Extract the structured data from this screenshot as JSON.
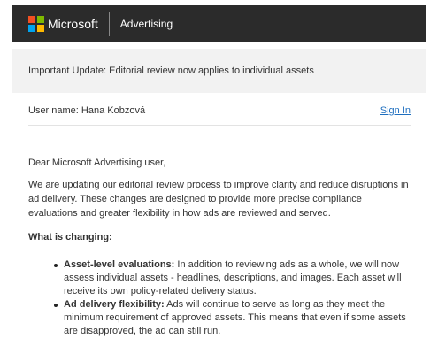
{
  "header": {
    "brand": "Microsoft",
    "product": "Advertising",
    "logo_colors": [
      "#f25022",
      "#7fba00",
      "#00a4ef",
      "#ffb900"
    ],
    "background": "#2b2b2b"
  },
  "notice": {
    "text": "Important Update: Editorial review now applies to individual assets"
  },
  "user": {
    "label": "User name: Hana Kobzová",
    "sign_in": "Sign In"
  },
  "body": {
    "greeting": "Dear Microsoft Advertising user,",
    "intro": "We are updating our editorial review process to improve clarity and reduce disruptions in ad delivery. These changes are designed to provide more precise compliance evaluations and greater flexibility in how ads are reviewed and served.",
    "changes_heading": "What is changing:",
    "changes": [
      {
        "title": "Asset-level evaluations:",
        "text": " In addition to reviewing ads as a whole, we will now assess individual assets - headlines, descriptions, and images. Each asset will receive its own policy-related delivery status."
      },
      {
        "title": "Ad delivery flexibility:",
        "text": " Ads will continue to serve as long as they meet the minimum requirement of approved assets. This means that even if some assets are disapproved, the ad can still run."
      }
    ]
  }
}
